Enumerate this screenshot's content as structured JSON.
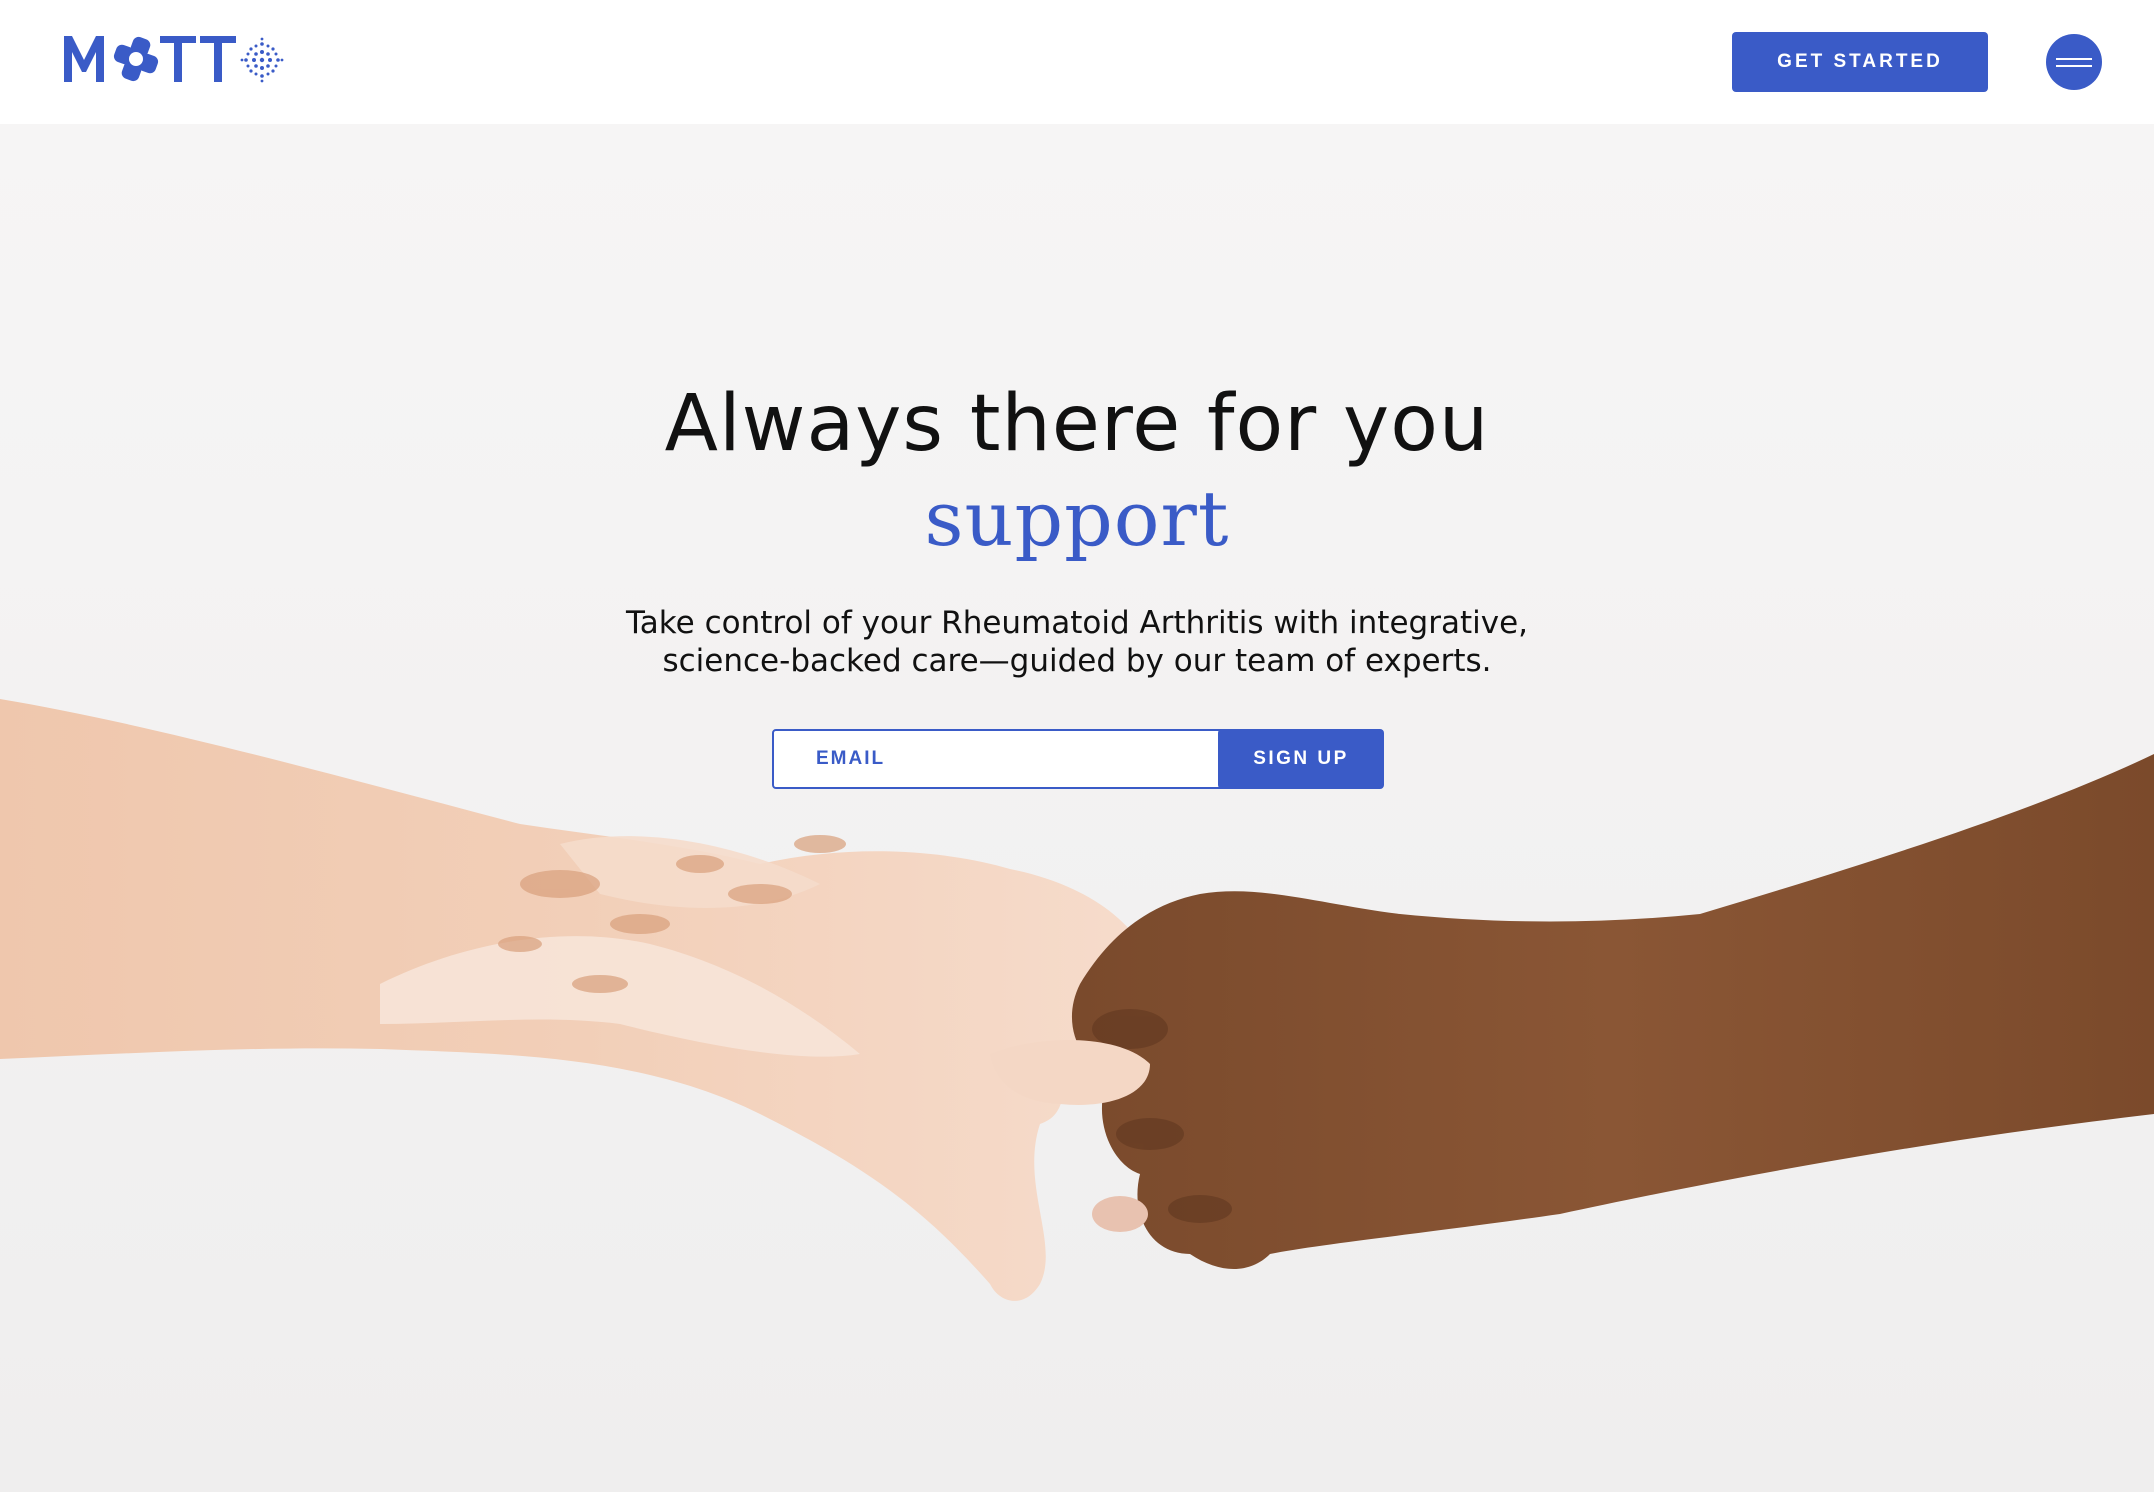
{
  "brand": {
    "logo_text": "MOTTO",
    "accent_color": "#3a5bc7"
  },
  "header": {
    "cta_label": "GET STARTED",
    "menu_icon": "hamburger-icon"
  },
  "hero": {
    "headline": "Always there for you",
    "rotating_word": "support",
    "subcopy_line1": "Take control of your Rheumatoid Arthritis with integrative,",
    "subcopy_line2": "science-backed care—guided by our team of experts.",
    "email_placeholder": "EMAIL",
    "signup_label": "SIGN UP",
    "image_description_icon": "hands-photo"
  }
}
